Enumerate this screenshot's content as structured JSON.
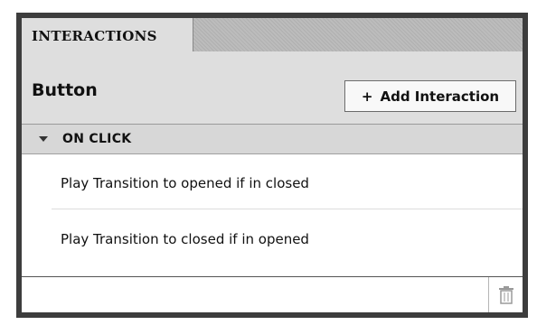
{
  "panel": {
    "tab_label": "INTERACTIONS"
  },
  "header": {
    "title": "Button",
    "add_button_icon": "+",
    "add_button_label": "Add Interaction"
  },
  "section": {
    "label": "ON CLICK",
    "icon": "triangle-down-icon"
  },
  "interactions": [
    {
      "label": "Play Transition to opened if in closed"
    },
    {
      "label": "Play Transition to closed if in opened"
    }
  ],
  "footer": {
    "delete_icon": "trash-icon"
  }
}
